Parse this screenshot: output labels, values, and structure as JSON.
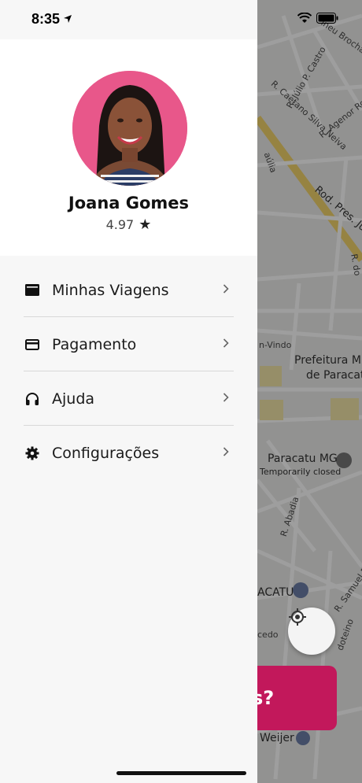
{
  "status_bar": {
    "time": "8:35"
  },
  "user": {
    "name": "Joana Gomes",
    "rating": "4.97"
  },
  "menu": {
    "items": [
      {
        "label": "Minhas Viagens",
        "icon": "wallet-icon"
      },
      {
        "label": "Pagamento",
        "icon": "credit-card-icon"
      },
      {
        "label": "Ajuda",
        "icon": "headphones-icon"
      },
      {
        "label": "Configurações",
        "icon": "gear-icon"
      }
    ]
  },
  "map": {
    "streets": {
      "s1": "ineu Brochado",
      "s2": "R. Júlio P. Castro",
      "s3": "R. Agenor Rodri",
      "s4": "R. Caetano Silva Neiva",
      "s5": "Rod. Pres. Ju",
      "s6": "R. do",
      "s7": "n-Vindo",
      "s8": "R. Abadia",
      "s9": "R. Samuel Ro",
      "s10": "doteino",
      "s11": "cedo",
      "s12": "aúlia"
    },
    "places": {
      "prefeitura_line1": "Prefeitura Mu",
      "prefeitura_line2": "de Paracat",
      "school": "Paracatu MG",
      "school_status": "Temporarily closed",
      "paracatu": "ACATU",
      "weijer": "Weijer"
    }
  },
  "cta": {
    "label": "s?"
  },
  "colors": {
    "accent": "#c2185b",
    "avatar_bg": "#e8578a"
  }
}
